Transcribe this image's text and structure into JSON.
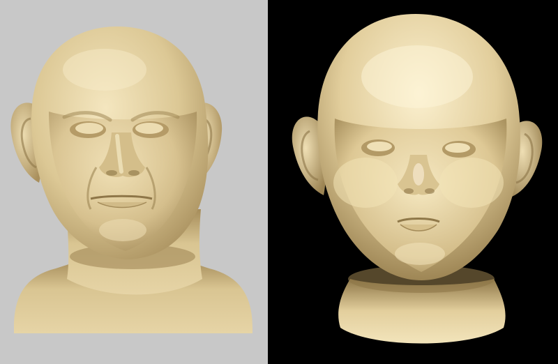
{
  "panels": [
    {
      "id": "left",
      "subject": "adult-male-head",
      "background": "#c8c8c8"
    },
    {
      "id": "right",
      "subject": "child-head",
      "background": "#000000"
    }
  ],
  "colors": {
    "skin_base": "#e2cfa0",
    "skin_highlight": "#f7ecc9",
    "skin_shadow": "#a88f5d",
    "skin_deep_shadow": "#7b6640"
  }
}
